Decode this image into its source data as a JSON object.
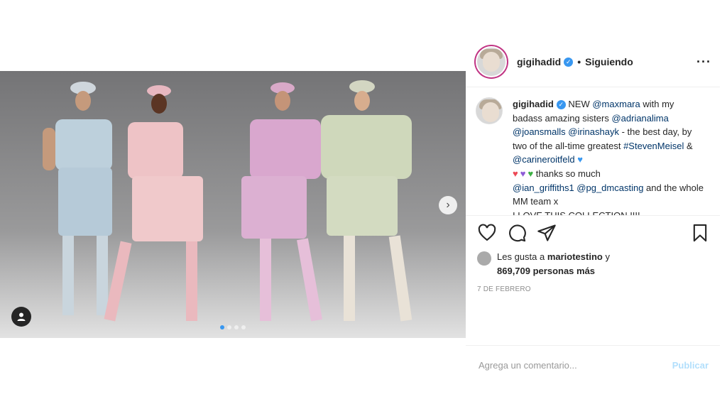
{
  "post": {
    "username": "gigihadid",
    "follow_sep": "•",
    "follow_label": "Siguiendo",
    "more_icon": "more-horizontal-icon",
    "caption": {
      "username": "gigihadid",
      "parts": {
        "p1": "NEW ",
        "m1": "@maxmara",
        "p2": " with my badass amazing sisters ",
        "m2": "@adrianalima",
        "m3": "@joansmalls",
        "m4": "@irinashayk",
        "p3": " - the best day, by two of the all-time greatest ",
        "m5": "#StevenMeisel",
        "p4": " & ",
        "m6": "@carineroitfeld",
        "p5": " thanks so much ",
        "m7": "@ian_griffiths1",
        "m8": "@pg_dmcasting",
        "p6": " and the whole MM team x",
        "p7": "I LOVE THIS COLLECTION !!!!"
      },
      "hearts_colors": [
        "#3897f0",
        "#ed4956",
        "#8e5bd6",
        "#3cb043"
      ]
    },
    "likes": {
      "prefix": "Les gusta a ",
      "user": "mariotestino",
      "mid": " y",
      "count": "869,709 personas más"
    },
    "date": "7 DE FEBRERO",
    "comment": {
      "placeholder": "Agrega un comentario...",
      "publish": "Publicar"
    },
    "carousel": {
      "total": 4,
      "active": 1
    }
  },
  "colors": {
    "accent": "#3897f0",
    "publish_disabled": "#b2dffc"
  }
}
